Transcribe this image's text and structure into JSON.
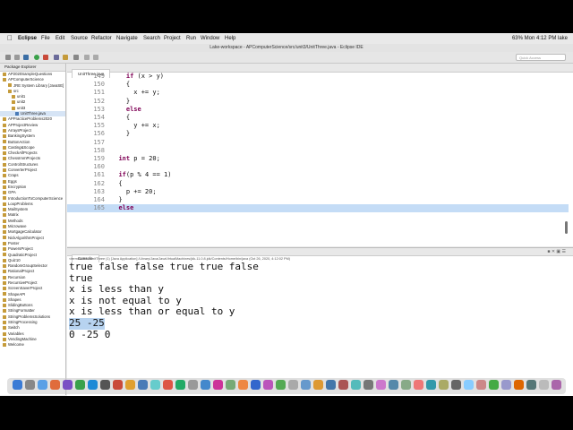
{
  "menubar": {
    "app": "Eclipse",
    "items": [
      "File",
      "Edit",
      "Source",
      "Refactor",
      "Navigate",
      "Search",
      "Project",
      "Run",
      "Window",
      "Help"
    ],
    "status": "63%   Mon 4:12 PM   lake"
  },
  "window": {
    "title": "Lake-workspace - APComputerScience/src/unit3/UnitThree.java - Eclipse IDE"
  },
  "toolbar": {
    "quick_access": "Quick Access"
  },
  "package_explorer": {
    "title": "Package Explorer",
    "items": [
      "AP2020SampleQuestions",
      "APComputerScience",
      "JRE System Library [JavaSE]",
      "src",
      "unit1",
      "unit2",
      "unit3",
      "UnitThree.java",
      "APPracticeProblems2020",
      "APProjectReview",
      "ArraysProject",
      "BankingSystem",
      "ButtonAction",
      "Casting&Scope",
      "CheckAllProjects",
      "ChessImmProjects",
      "ControlStructures",
      "ConverterProject",
      "Craps",
      "Eggs",
      "Encryption",
      "GPA",
      "IntroductionToComputerScience",
      "LoopProblems",
      "MailSystem",
      "Matrix",
      "Methods",
      "Microwave",
      "MortgageCalculator",
      "NickAlgorithmProject",
      "Poster",
      "PowersProject",
      "QuadraticProject",
      "Quiz10",
      "RandomGroupSelector",
      "RationalProject",
      "Recursion",
      "RecursiveProject",
      "ScreenSaverProject",
      "ShapeAPI",
      "Shapes",
      "SlidingButtons",
      "StringFormatter",
      "StringProblemsSolutions",
      "StringProcessing",
      "Switch",
      "Variables",
      "VendingMachine",
      "Welcome"
    ]
  },
  "editor": {
    "tab": "UnitThree.java",
    "lines": [
      {
        "n": "149",
        "code": "    if (x > y)"
      },
      {
        "n": "150",
        "code": "    {"
      },
      {
        "n": "151",
        "code": "      x += y;"
      },
      {
        "n": "152",
        "code": "    }"
      },
      {
        "n": "153",
        "code": "    else"
      },
      {
        "n": "154",
        "code": "    {"
      },
      {
        "n": "155",
        "code": "      y += x;"
      },
      {
        "n": "156",
        "code": "    }"
      },
      {
        "n": "157",
        "code": ""
      },
      {
        "n": "158",
        "code": ""
      },
      {
        "n": "159",
        "code": "  int p = 20;"
      },
      {
        "n": "160",
        "code": ""
      },
      {
        "n": "161",
        "code": "  if(p % 4 == 1)"
      },
      {
        "n": "162",
        "code": "  {"
      },
      {
        "n": "163",
        "code": "    p += 20;"
      },
      {
        "n": "164",
        "code": "  }"
      },
      {
        "n": "165",
        "code": "  else"
      }
    ]
  },
  "console": {
    "tab": "Console",
    "status": "<terminated> UnitThree (1) [Java Application] /Library/Java/JavaVirtualMachines/jdk-11.0.8.jdk/Contents/Home/bin/java (Oct 26, 2020, 4:12:02 PM)",
    "lines": [
      "true false false true true false",
      "true",
      "x is less than y",
      "x is not equal to y",
      "x is less than or equal to y",
      "25 -25",
      "0 -25 0"
    ]
  },
  "colors": {
    "keyword": "#7f0055",
    "selection": "#b7d3f0",
    "current_line": "#c4dcf6"
  }
}
